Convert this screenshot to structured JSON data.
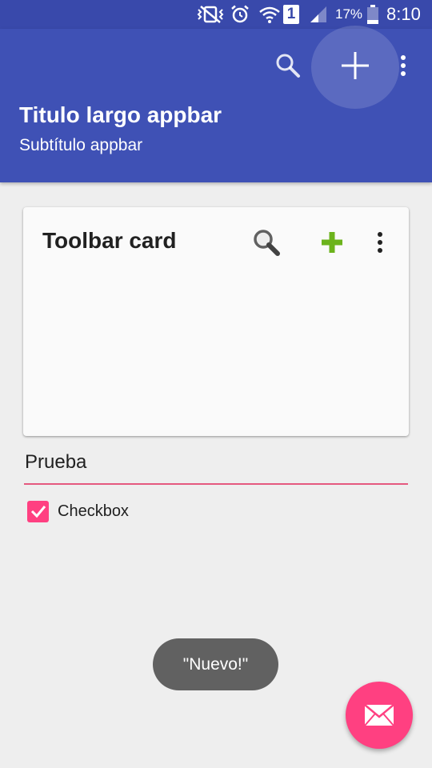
{
  "status_bar": {
    "battery_percent": "17%",
    "time": "8:10",
    "sim_slot": "1",
    "icons": [
      "vibrate-icon",
      "alarm-icon",
      "wifi-icon",
      "sim-icon",
      "signal-icon",
      "battery-icon"
    ]
  },
  "appbar": {
    "title": "Titulo largo appbar",
    "subtitle": "Subtítulo appbar",
    "actions": [
      "search-icon",
      "add-icon",
      "overflow-menu-icon"
    ]
  },
  "card": {
    "title": "Toolbar card",
    "actions": [
      "search-icon",
      "add-icon",
      "overflow-menu-icon"
    ]
  },
  "input": {
    "value": "Prueba"
  },
  "checkbox": {
    "label": "Checkbox",
    "checked": true
  },
  "toast": {
    "message": "\"Nuevo!\""
  },
  "fab": {
    "icon": "mail-icon"
  },
  "colors": {
    "status_bar": "#3949ab",
    "appbar": "#3f51b5",
    "accent": "#ff4081",
    "background": "#eeeeee",
    "card": "#fafafa",
    "toast": "#616161"
  }
}
